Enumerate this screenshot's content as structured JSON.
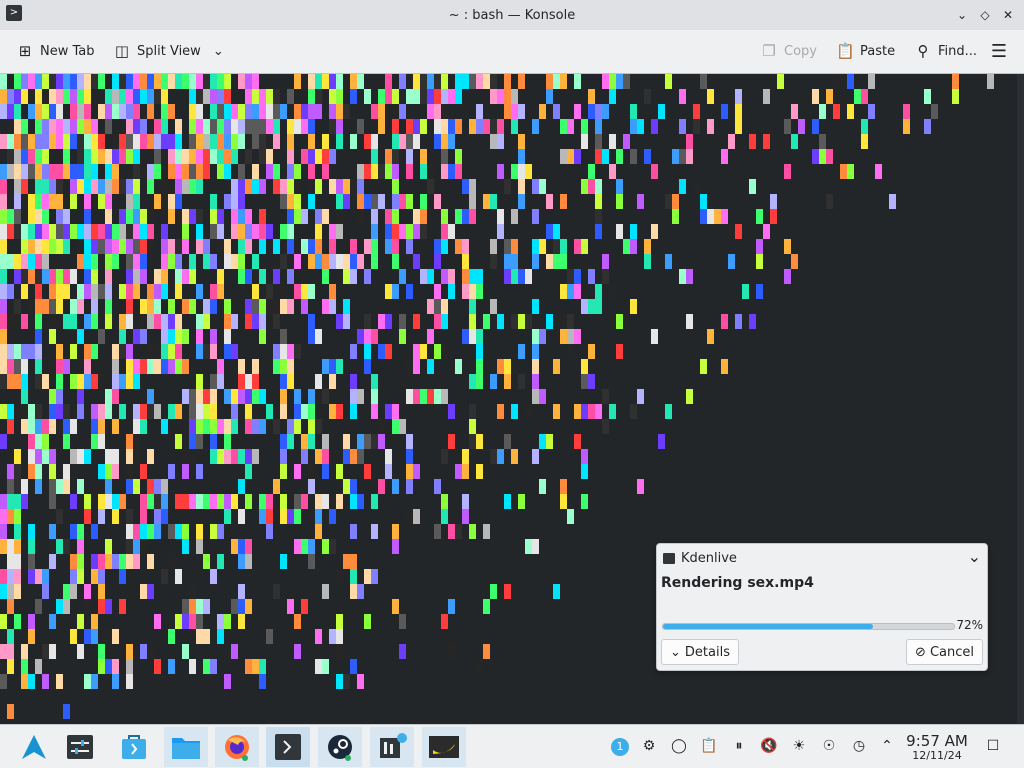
{
  "window": {
    "title": "~ : bash — Konsole",
    "app_icon": "terminal-icon",
    "controls": [
      "chevron-down-icon",
      "diamond-icon",
      "close-icon"
    ]
  },
  "toolbar": {
    "new_tab_label": "New Tab",
    "split_view_label": "Split View",
    "copy_label": "Copy",
    "paste_label": "Paste",
    "find_label": "Find..."
  },
  "terminal": {
    "palette": [
      "#e6e6e6",
      "#ff3d3d",
      "#ff6ef0",
      "#c05cff",
      "#6c3cff",
      "#2d5cff",
      "#3d9dff",
      "#00e5ff",
      "#23e8b4",
      "#3dff6e",
      "#8cff3d",
      "#c8ff3d",
      "#ffe63d",
      "#ffb33d",
      "#ff8c3d",
      "#ff4fa3",
      "#b3b3ff",
      "#99ffcc",
      "#ffd9a6",
      "#ff99c8",
      "#7f7fff",
      "#b8b8b8",
      "#5a5a5a",
      "#303030",
      "#262626"
    ]
  },
  "notification": {
    "app_name": "Kdenlive",
    "title": "Rendering sex.mp4",
    "progress_percent": 72,
    "progress_label": "72%",
    "details_label": "Details",
    "cancel_label": "Cancel"
  },
  "taskbar": {
    "apps": [
      "app-launcher-icon",
      "system-settings-icon",
      "discover-icon",
      "file-manager-icon",
      "firefox-icon",
      "konsole-icon",
      "steam-icon",
      "kdenlive-icon",
      "banana-app-icon"
    ],
    "tray_badge": "1",
    "clock_time": "9:57 AM",
    "clock_date": "12/11/24"
  }
}
